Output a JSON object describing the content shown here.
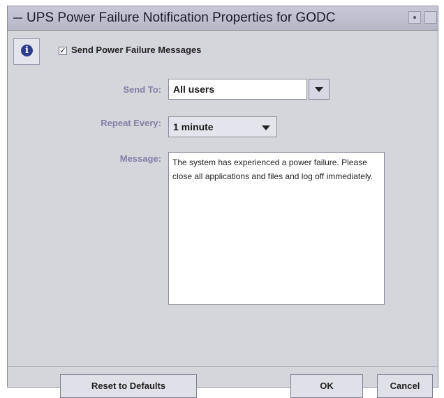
{
  "window": {
    "title": "UPS Power Failure Notification Properties for GODC"
  },
  "info_icon_glyph": "i",
  "notification": {
    "checkbox_glyph": "✓",
    "send_messages_label": "Send Power Failure Messages",
    "send_messages_checked": true
  },
  "form": {
    "send_to_label": "Send To:",
    "send_to_value": "All users",
    "repeat_label": "Repeat Every:",
    "repeat_value": "1 minute",
    "message_label": "Message:",
    "message_text": "The system has experienced a power failure.  Please close all applications and files and log off immediately."
  },
  "buttons": {
    "reset": "Reset to Defaults",
    "ok": "OK",
    "cancel": "Cancel"
  },
  "colors": {
    "window_bg": "#d5d5dc",
    "label_color": "#8080a8",
    "info_icon": "#2e3d8a"
  }
}
